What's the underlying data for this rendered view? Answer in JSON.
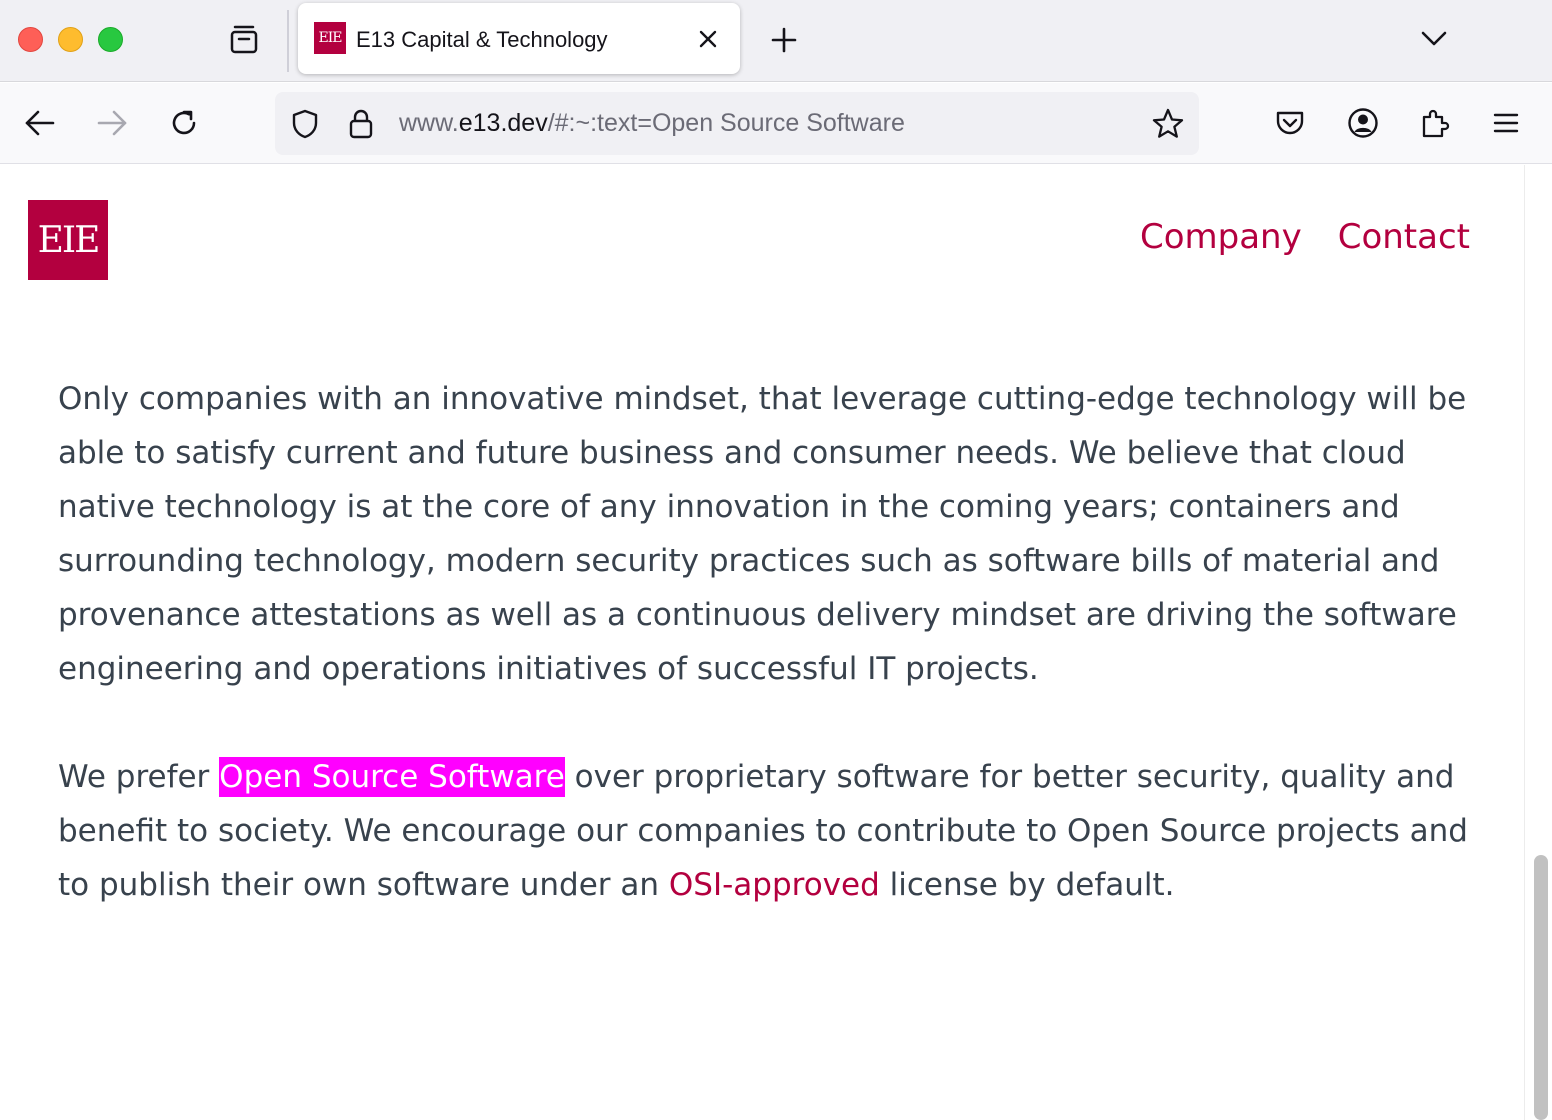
{
  "browser": {
    "tab": {
      "favicon_text": "EIE",
      "title": "E13 Capital & Technology"
    },
    "url": {
      "prefix": "www.",
      "host": "e13.dev",
      "path": "/#:~:text=Open Source Software"
    }
  },
  "site": {
    "logo_text": "EIE",
    "brand_color": "#b3003f",
    "nav": [
      {
        "label": "Company"
      },
      {
        "label": "Contact"
      }
    ]
  },
  "content": {
    "paragraph1": "Only companies with an innovative mindset, that leverage cutting-edge technology will be able to satisfy current and future business and consumer needs. We believe that cloud native technology is at the core of any innovation in the coming years; containers and surrounding technology, modern security practices such as software bills of material and provenance attestations as well as a continuous delivery mindset are driving the software engineering and operations initiatives of successful IT projects.",
    "paragraph2": {
      "before_highlight": "We prefer ",
      "highlight": "Open Source Software",
      "after_highlight": " over proprietary software for better security, quality and benefit to society. We encourage our companies to contribute to Open Source projects and to publish their own software under an ",
      "link": "OSI-approved",
      "after_link": " license by default."
    },
    "highlight_color": "#ff00ff"
  }
}
